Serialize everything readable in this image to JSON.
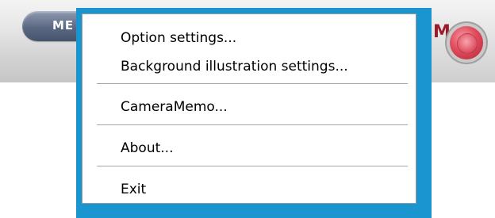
{
  "toolbar": {
    "menu_button_label": "ME",
    "right_label": "M"
  },
  "context_menu": {
    "items": [
      {
        "label": "Option settings..."
      },
      {
        "label": "Background illustration settings..."
      },
      {
        "label": "CameraMemo..."
      },
      {
        "label": "About..."
      },
      {
        "label": "Exit"
      }
    ]
  },
  "colors": {
    "highlight": "#1b95cf",
    "menu_button": "#5b6883",
    "close_button": "#e04c5e"
  }
}
